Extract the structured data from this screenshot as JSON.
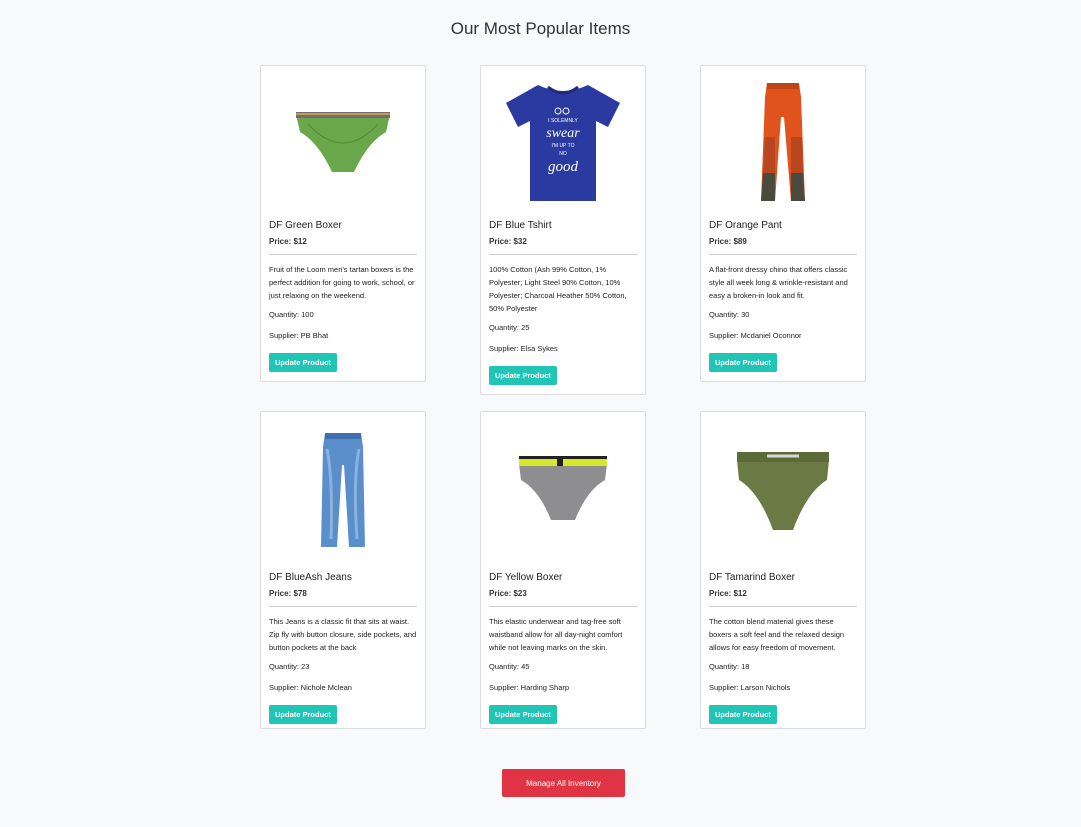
{
  "page": {
    "title": "Our Most Popular Items",
    "manage_label": "Manage All Inventory"
  },
  "products": [
    {
      "name": "DF Green Boxer",
      "price": "Price: $12",
      "description": "Fruit of the Loom men's tartan boxers is the perfect addition for going to work, school, or just relaxing on the weekend.",
      "quantity": "Quantity: 100",
      "supplier": "Supplier: PB Bhat",
      "button": "Update Product",
      "image": "green-briefs-icon"
    },
    {
      "name": "DF Blue Tshirt",
      "price": "Price: $32",
      "description": "100% Cotton (Ash 99% Cotton, 1% Polyester; Light Steel 90% Cotton, 10% Polyester; Charcoal Heather 50% Cotton, 50% Polyester",
      "quantity": "Quantity: 25",
      "supplier": "Supplier: Elsa Sykes",
      "button": "Update Product",
      "image": "blue-tshirt-icon"
    },
    {
      "name": "DF Orange Pant",
      "price": "Price: $89",
      "description": "A flat-front dressy chino that offers classic style all week long & wrinkle-resistant and easy a broken-in look and fit.",
      "quantity": "Quantity: 30",
      "supplier": "Supplier: Mcdaniel Oconnor",
      "button": "Update Product",
      "image": "orange-pants-icon"
    },
    {
      "name": "DF BlueAsh Jeans",
      "price": "Price: $78",
      "description": "This Jeans is a classic fit that sits at waist. Zip fly with button closure, side pockets, and button pockets at the back",
      "quantity": "Quantity: 23",
      "supplier": "Supplier: Nichole Mclean",
      "button": "Update Product",
      "image": "blue-jeans-icon"
    },
    {
      "name": "DF Yellow Boxer",
      "price": "Price: $23",
      "description": "This elastic underwear and tag-free soft waistband allow for all day-night comfort while not leaving marks on the skin.",
      "quantity": "Quantity: 45",
      "supplier": "Supplier: Harding Sharp",
      "button": "Update Product",
      "image": "grey-yellow-briefs-icon"
    },
    {
      "name": "DF Tamarind Boxer",
      "price": "Price: $12",
      "description": "The cotton blend material gives these boxers a soft feel and the relaxed design allows for easy freedom of movement.",
      "quantity": "Quantity: 18",
      "supplier": "Supplier: Larson Nichols",
      "button": "Update Product",
      "image": "olive-briefs-icon"
    }
  ],
  "tshirt_print": {
    "line1": "I SOLEMNLY",
    "line2": "swear",
    "line3": "I'M UP TO",
    "line4": "NO",
    "line5": "good"
  }
}
